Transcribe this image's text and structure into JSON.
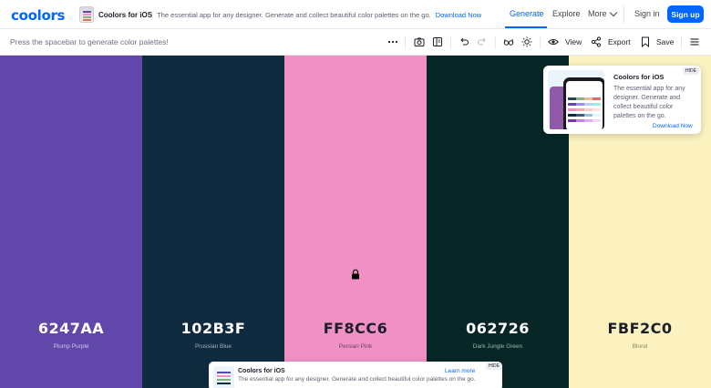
{
  "header": {
    "logo": "coolors",
    "promo": {
      "title": "Coolors for iOS",
      "text": "The essential app for any designer. Generate and collect beautiful color palettes on the go.",
      "link": "Download Now"
    },
    "nav": {
      "generate": "Generate",
      "explore": "Explore",
      "more": "More",
      "signin": "Sign in",
      "signup": "Sign up"
    }
  },
  "toolbar": {
    "hint": "Press the spacebar to generate color palettes!",
    "view": "View",
    "export": "Export",
    "save": "Save",
    "icons": [
      "more-icon",
      "camera-icon",
      "panel-icon",
      "undo-icon",
      "redo-icon",
      "glasses-icon",
      "sun-icon",
      "eye-icon",
      "share-icon",
      "bookmark-icon",
      "menu-icon"
    ]
  },
  "palette": {
    "colors": [
      {
        "hex": "6247AA",
        "name": "Plump Purple",
        "bg": "#6247aa",
        "fg": "#ffffff",
        "sub": "#cfc6ea"
      },
      {
        "hex": "102B3F",
        "name": "Prussian Blue",
        "bg": "#102b3f",
        "fg": "#ffffff",
        "sub": "#a3b3c2"
      },
      {
        "hex": "FF8CC6",
        "name": "Persian Pink",
        "bg": "#f090c5",
        "fg": "#1c1f2a",
        "sub": "#6b3f57",
        "locked": true
      },
      {
        "hex": "062726",
        "name": "Dark Jungle Green",
        "bg": "#062726",
        "fg": "#ffffff",
        "sub": "#9fb3b2"
      },
      {
        "hex": "FBF2C0",
        "name": "Blond",
        "bg": "#fbf2c0",
        "fg": "#1c1f2a",
        "sub": "#8a8468"
      }
    ]
  },
  "popup": {
    "title": "Coolors for iOS",
    "text": "The essential app for any designer. Generate and collect beautiful color palettes on the go.",
    "link": "Download Now",
    "hide": "HIDE"
  },
  "banner": {
    "title": "Coolors for iOS",
    "text": "The essential app for any designer. Generate and collect beautiful color palettes on the go.",
    "link": "Learn more",
    "hide": "HIDE"
  }
}
